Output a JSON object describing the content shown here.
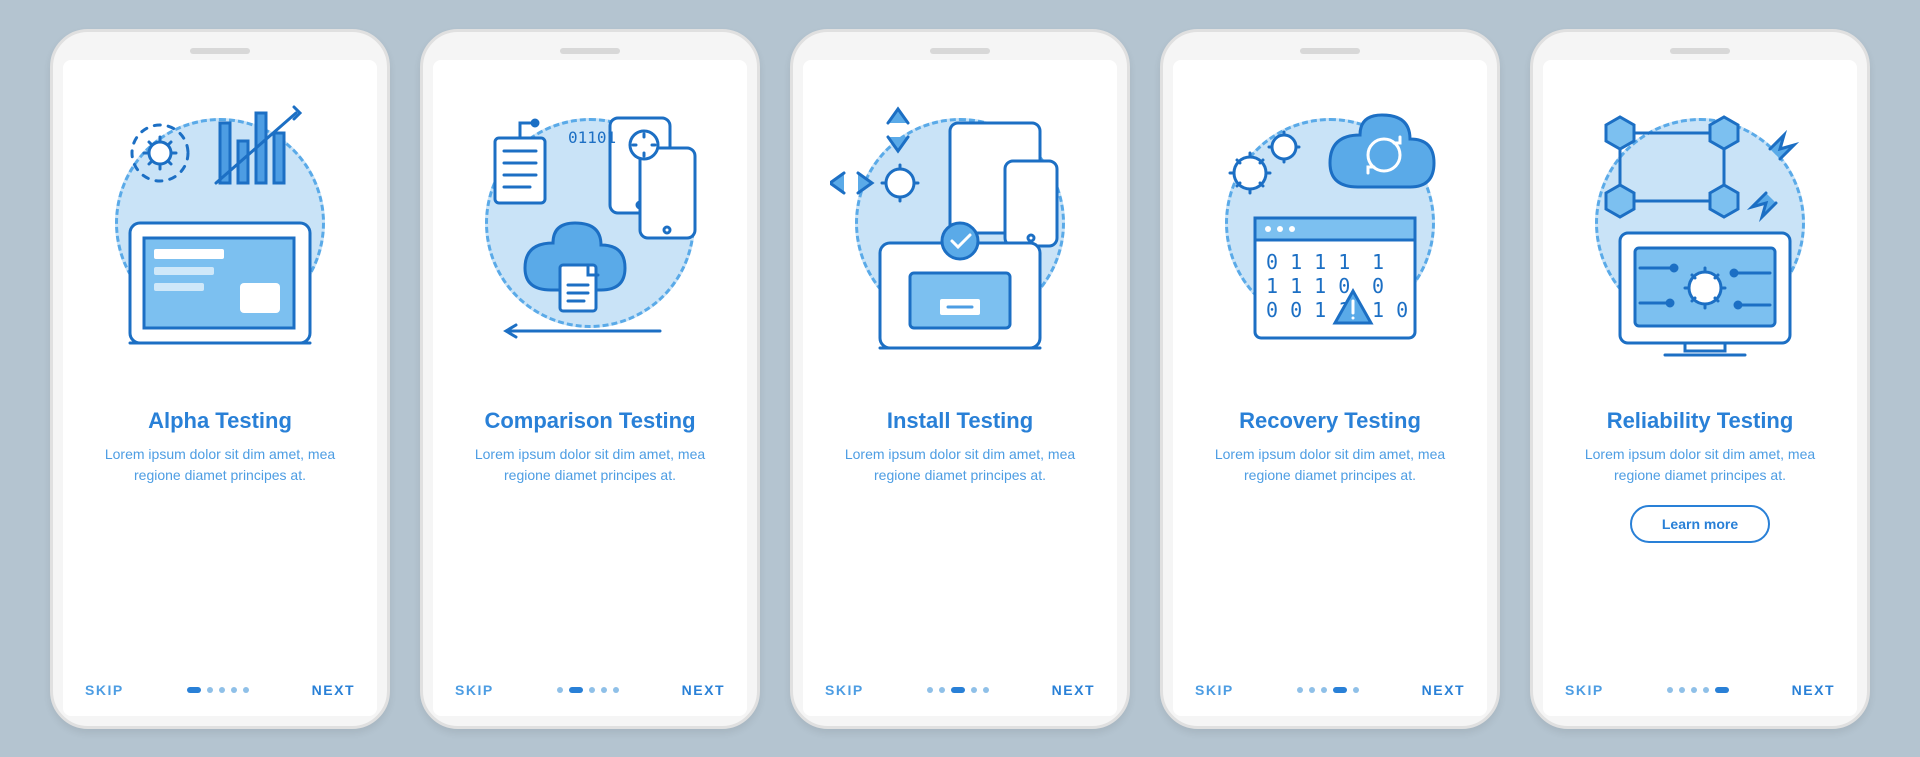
{
  "screens": [
    {
      "title": "Alpha Testing",
      "body": "Lorem ipsum dolor sit dim amet, mea regione diamet principes at.",
      "learn": false,
      "active": 0
    },
    {
      "title": "Comparison Testing",
      "body": "Lorem ipsum dolor sit dim amet, mea regione diamet principes at.",
      "learn": false,
      "active": 1
    },
    {
      "title": "Install Testing",
      "body": "Lorem ipsum dolor sit dim amet, mea regione diamet principes at.",
      "learn": false,
      "active": 2
    },
    {
      "title": "Recovery Testing",
      "body": "Lorem ipsum dolor sit dim amet, mea regione diamet principes at.",
      "learn": false,
      "active": 3
    },
    {
      "title": "Reliability Testing",
      "body": "Lorem ipsum dolor sit dim amet, mea regione diamet principes at.",
      "learn": true,
      "active": 4
    }
  ],
  "skip": "SKIP",
  "next": "NEXT",
  "learn_more": "Learn more"
}
